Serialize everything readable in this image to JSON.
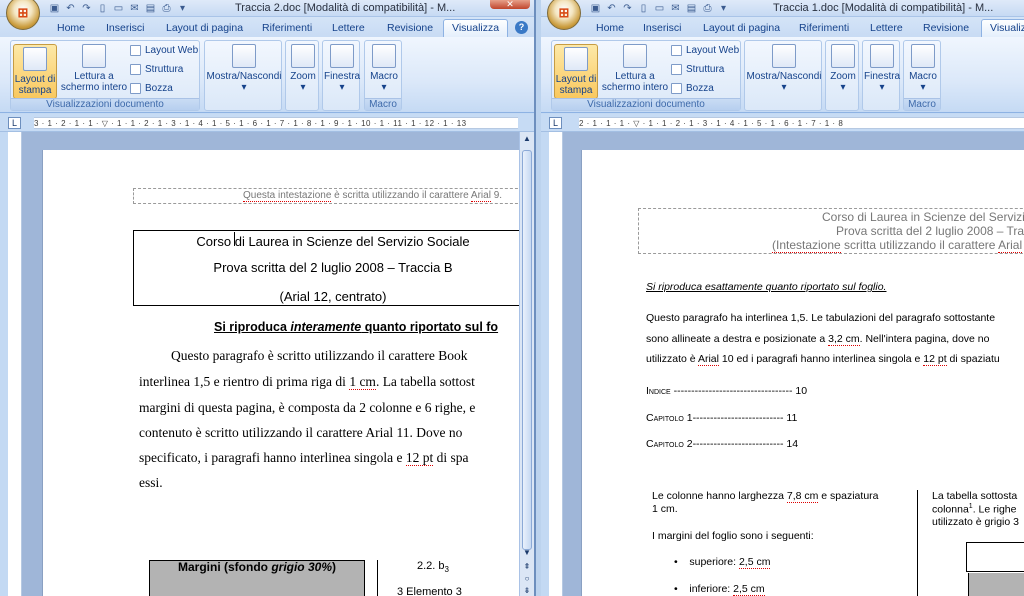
{
  "left_window": {
    "title": "Traccia 2.doc [Modalità di compatibilità] - M...",
    "close_label": "✕",
    "tabs": [
      "Home",
      "Inserisci",
      "Layout di pagina",
      "Riferimenti",
      "Lettere",
      "Revisione",
      "Visualizza"
    ],
    "active_tab": "Visualizza",
    "ribbon": {
      "layout_stampa_1": "Layout di",
      "layout_stampa_2": "stampa",
      "lettura_1": "Lettura a",
      "lettura_2": "schermo intero",
      "layout_web": "Layout Web",
      "struttura": "Struttura",
      "bozza": "Bozza",
      "group_views": "Visualizzazioni documento",
      "mostra": "Mostra/Nascondi",
      "zoom": "Zoom",
      "finestra": "Finestra",
      "macro": "Macro",
      "group_macro": "Macro"
    },
    "ruler_text": "3 · 1 · 2 · 1 · 1 · ▽ · 1 · 1 · 2 · 1 · 3 · 1 · 4 · 1 · 5 · 1 · 6 · 1 · 7 · 1 · 8 · 1 · 9 · 1 · 10 · 1 · 11 · 1 · 12 · 1 · 13",
    "page": {
      "header_note_a": "Questa intestazione",
      "header_note_b": " è scritta utilizzando il carattere ",
      "header_note_c": "Arial",
      "header_note_d": " 9.",
      "box_line1": "Corso di Laurea in Scienze del Servizio Sociale",
      "box_line2": "Prova scritta del 2 luglio 2008 – Traccia B",
      "box_line3": "(Arial 12, centrato)",
      "heading_a": "Si riproduca ",
      "heading_b": "interamente",
      "heading_c": " quanto riportato sul fo",
      "para_line1": "Questo paragrafo è scritto utilizzando il carattere Book",
      "para_line2a": "interlinea 1,5 e rientro di prima riga di ",
      "para_line2b": "1 cm",
      "para_line2c": ". La tabella sottost",
      "para_line3": "margini di questa pagina, è composta da 2 colonne e 6 righe, e",
      "para_line4": "contenuto è scritto utilizzando il carattere Arial 11. Dove no",
      "para_line5a": "specificato, i paragrafi hanno interlinea singola e ",
      "para_line5b": "12 pt",
      "para_line5c": " di spa",
      "para_line6": "essi.",
      "table_header_a": "Margini (sfondo ",
      "table_header_b": "grigio 30%",
      "table_header_c": ")",
      "right_item1": "2.2.  b",
      "right_item1_sub": "3",
      "right_item2": "3     Elemento 3"
    }
  },
  "right_window": {
    "title": "Traccia 1.doc [Modalità di compatibilità] - M...",
    "tabs": [
      "Home",
      "Inserisci",
      "Layout di pagina",
      "Riferimenti",
      "Lettere",
      "Revisione",
      "Visualiz"
    ],
    "active_tab": "Visualiz",
    "ruler_text": "2 · 1 · 1 · 1 · ▽ · 1 · 1 · 2 · 1 · 3 · 1 · 4 · 1 · 5 · 1 · 6 · 1 · 7 · 1 · 8",
    "page": {
      "header_line1": "Corso di Laurea in Scienze del Servizio S",
      "header_line2": "Prova scritta del 2 luglio 2008 – Tracc",
      "header_line3a": "(Intestazione",
      "header_line3b": " scritta utilizzando  il carattere ",
      "header_line3c": "Arial",
      "header_line3d": " di",
      "instruction": "Si riproduca esattamente quanto riportato sul foglio.",
      "para_line1": "Questo paragrafo ha interlinea 1,5. Le tabulazioni del paragrafo sottostante",
      "para_line2a": "sono allineate a destra e posizionate a ",
      "para_line2b": "3,2 cm",
      "para_line2c": ". Nell'intera pagina, dove no",
      "para_line3a": "utilizzato è ",
      "para_line3b": "Arial",
      "para_line3c": " 10 ed i paragrafi hanno interlinea singola e ",
      "para_line3d": "12 pt",
      "para_line3e": " di spaziatu",
      "toc1_label": "Indice",
      "toc1_dots": " ---------------------------------- ",
      "toc1_num": "10",
      "toc2_label": "Capitolo 1",
      "toc2_dots": "-------------------------- ",
      "toc2_num": "11",
      "toc3_label": "Capitolo 2",
      "toc3_dots": "-------------------------- ",
      "toc3_num": "14",
      "col_text1a": "Le colonne hanno larghezza ",
      "col_text1b": "7,8 cm",
      "col_text1c": " e spaziatura",
      "col_text2": "1 cm.",
      "margins_intro": "I margini del foglio sono i seguenti:",
      "bullet1a": "superiore: ",
      "bullet1b": "2,5 cm",
      "bullet2a": "inferiore: ",
      "bullet2b": "2,5 cm",
      "rcol_line1": "La tabella sottosta",
      "rcol_line2a": "colonna",
      "rcol_line2b": "1",
      "rcol_line2c": ". Le righe",
      "rcol_line3": "utilizzato è grigio 3"
    }
  },
  "colors": {
    "ribbon_bg": "#dbe8f9",
    "accent": "#15428b",
    "selected_button": "#f9c85f",
    "doc_bg": "#9fb6d8"
  }
}
